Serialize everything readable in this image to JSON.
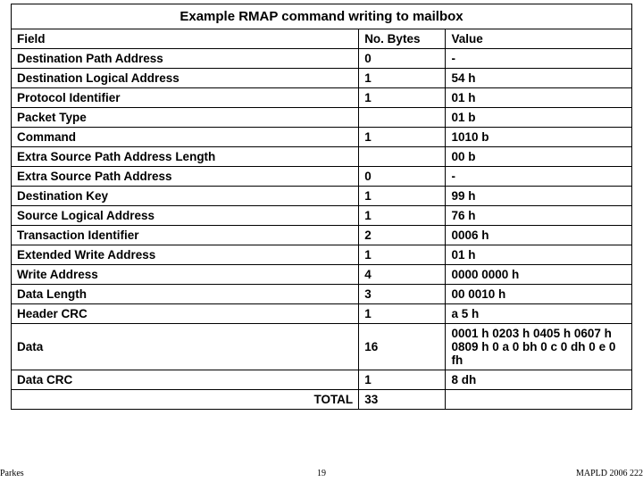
{
  "title": "Example RMAP command writing to mailbox",
  "headers": {
    "field": "Field",
    "bytes": "No. Bytes",
    "value": "Value"
  },
  "rows": [
    {
      "field": "Destination Path Address",
      "bytes": "0",
      "value": "-"
    },
    {
      "field": "Destination Logical Address",
      "bytes": "1",
      "value": "54 h"
    },
    {
      "field": "Protocol Identifier",
      "bytes": "1",
      "value": "01 h"
    },
    {
      "field": "Packet Type",
      "bytes": "",
      "value": "01 b"
    },
    {
      "field": "Command",
      "bytes": "1",
      "value": "1010 b"
    },
    {
      "field": "Extra Source Path Address Length",
      "bytes": "",
      "value": "00 b"
    },
    {
      "field": "Extra Source Path Address",
      "bytes": "0",
      "value": "-"
    },
    {
      "field": "Destination Key",
      "bytes": "1",
      "value": "99 h"
    },
    {
      "field": "Source Logical Address",
      "bytes": "1",
      "value": "76 h"
    },
    {
      "field": "Transaction Identifier",
      "bytes": "2",
      "value": "0006 h"
    },
    {
      "field": "Extended Write Address",
      "bytes": "1",
      "value": "01 h"
    },
    {
      "field": "Write Address",
      "bytes": "4",
      "value": "0000 0000 h"
    },
    {
      "field": "Data Length",
      "bytes": "3",
      "value": "00 0010 h"
    },
    {
      "field": "Header CRC",
      "bytes": "1",
      "value": "a 5 h"
    },
    {
      "field": "Data",
      "bytes": "16",
      "value": "0001 h 0203 h 0405 h 0607 h 0809 h 0 a 0 bh 0 c 0 dh 0 e 0 fh"
    },
    {
      "field": "Data CRC",
      "bytes": "1",
      "value": "8 dh"
    }
  ],
  "total": {
    "label": "TOTAL",
    "bytes": "33"
  },
  "footer": {
    "left": "Parkes",
    "mid": "19",
    "right": "MAPLD 2006 222"
  },
  "chart_data": {
    "type": "table",
    "title": "Example RMAP command writing to mailbox",
    "columns": [
      "Field",
      "No. Bytes",
      "Value"
    ],
    "rows": [
      [
        "Destination Path Address",
        "0",
        "-"
      ],
      [
        "Destination Logical Address",
        "1",
        "54 h"
      ],
      [
        "Protocol Identifier",
        "1",
        "01 h"
      ],
      [
        "Packet Type",
        "",
        "01 b"
      ],
      [
        "Command",
        "1",
        "1010 b"
      ],
      [
        "Extra Source Path Address Length",
        "",
        "00 b"
      ],
      [
        "Extra Source Path Address",
        "0",
        "-"
      ],
      [
        "Destination Key",
        "1",
        "99 h"
      ],
      [
        "Source Logical Address",
        "1",
        "76 h"
      ],
      [
        "Transaction Identifier",
        "2",
        "0006 h"
      ],
      [
        "Extended Write Address",
        "1",
        "01 h"
      ],
      [
        "Write Address",
        "4",
        "0000 0000 h"
      ],
      [
        "Data Length",
        "3",
        "00 0010 h"
      ],
      [
        "Header CRC",
        "1",
        "a 5 h"
      ],
      [
        "Data",
        "16",
        "0001 h 0203 h 0405 h 0607 h 0809 h 0 a 0 bh 0 c 0 dh 0 e 0 fh"
      ],
      [
        "Data CRC",
        "1",
        "8 dh"
      ],
      [
        "TOTAL",
        "33",
        ""
      ]
    ]
  }
}
